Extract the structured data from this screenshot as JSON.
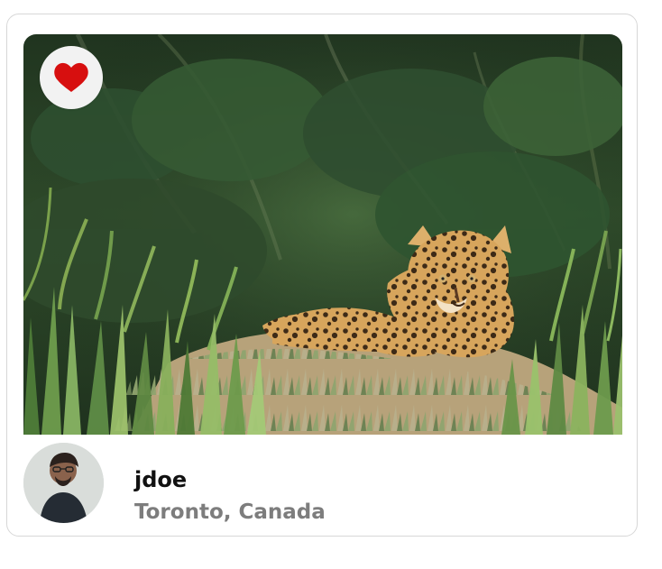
{
  "card": {
    "photo_subject": "jaguar-photo",
    "liked": true
  },
  "user": {
    "username": "jdoe",
    "location": "Toronto, Canada"
  },
  "colors": {
    "heart": "#d70f0f",
    "like_bg": "#f2f2f2",
    "location_text": "#7d7d7d",
    "username_text": "#111111"
  },
  "icons": {
    "like": "heart-icon"
  }
}
